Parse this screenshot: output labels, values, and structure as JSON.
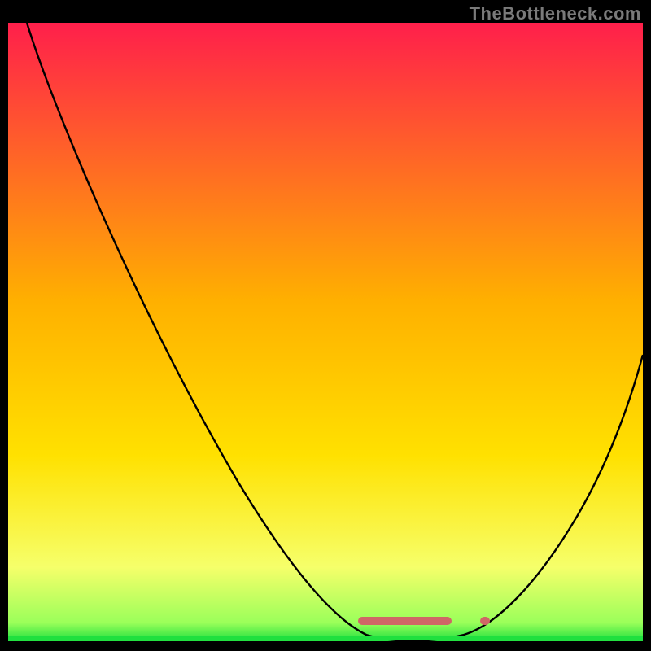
{
  "watermark": "TheBottleneck.com",
  "colors": {
    "frame_bg": "#000000",
    "gradient_top": "#ff1f4b",
    "gradient_mid": "#ffd400",
    "gradient_low": "#f6ff6a",
    "gradient_bottom": "#1fe03f",
    "curve": "#000000",
    "marker": "#cf6766",
    "watermark": "#7a7a7a"
  },
  "chart_data": {
    "type": "line",
    "title": "",
    "xlabel": "",
    "ylabel": "",
    "ylim": [
      0,
      100
    ],
    "xlim": [
      0,
      100
    ],
    "note": "Bottleneck-style V-curve over a red→yellow→green background gradient. Y maps to bottleneck severity (100 at top, 0 at bottom). X is a normalized component-balance axis. Values are read off pixel positions because the figure has no tick labels.",
    "series": [
      {
        "name": "bottleneck-curve",
        "x": [
          3,
          7,
          12,
          18,
          24,
          30,
          36,
          42,
          48,
          53,
          57,
          60,
          63,
          66,
          70,
          73,
          76,
          80,
          85,
          90,
          95,
          100
        ],
        "y": [
          100,
          91,
          82,
          71,
          61,
          51,
          42,
          32,
          22,
          13,
          7,
          3,
          1,
          0,
          0,
          1,
          4,
          9,
          17,
          27,
          39,
          52
        ]
      }
    ],
    "optimal_range_x": [
      55,
      75
    ],
    "markers": [
      {
        "name": "optimal-bar-left",
        "x_start": 55,
        "x_end": 70,
        "y": 0
      },
      {
        "name": "optimal-dot-right",
        "x_start": 74,
        "x_end": 76,
        "y": 0
      }
    ],
    "gradient_stops": [
      {
        "pos": 0.0,
        "color": "#ff1f4b"
      },
      {
        "pos": 0.45,
        "color": "#ffb000"
      },
      {
        "pos": 0.7,
        "color": "#ffe100"
      },
      {
        "pos": 0.88,
        "color": "#f6ff6a"
      },
      {
        "pos": 0.97,
        "color": "#9bff5a"
      },
      {
        "pos": 1.0,
        "color": "#1fe03f"
      }
    ]
  }
}
